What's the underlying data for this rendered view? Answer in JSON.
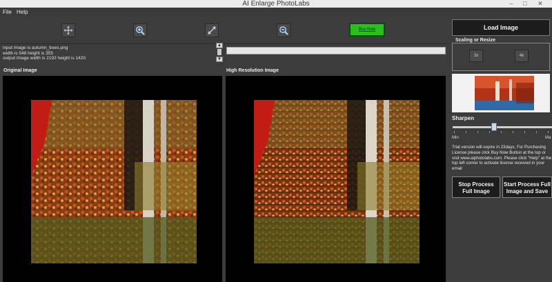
{
  "window": {
    "title": "AI Enlarge PhotoLabs"
  },
  "window_controls": {
    "minimize": "–",
    "maximize": "□",
    "close": "✕"
  },
  "menu": {
    "file": "File",
    "help": "Help"
  },
  "toolbar": {
    "icons": [
      "move-icon",
      "zoom-in-icon",
      "fit-screen-icon",
      "zoom-out-icon"
    ],
    "buy_now_label": "Buy Now",
    "buy_now_color": "#2abf1a"
  },
  "info": {
    "line1": "input image is autumn_trees.png",
    "line2": "width is 548 height is 355",
    "line3": "output Image width is 2192 height is 1420"
  },
  "panels": {
    "original_title": "Original Image",
    "high_res_title": "High Resolution Image"
  },
  "sidebar": {
    "load_label": "Load Image",
    "scaling_legend": "Scaling or Resize",
    "scale_2x": "2x",
    "scale_4x": "4x",
    "sharpen_label": "Sharpen",
    "sharpen_value": 0.42,
    "slider_min": "Min",
    "slider_max": "Ma",
    "trial_text": "Trial version will expire in 23days, For Purchasing License please click Buy Now Button at the top or visit www.aiphotolabs.com. Please click \"Help\" at the top left corner to activate license received in your email",
    "stop_line1": "Stop Process",
    "stop_line2": "Full Image",
    "start_line1": "Start Process Full",
    "start_line2": "Image and Save"
  }
}
